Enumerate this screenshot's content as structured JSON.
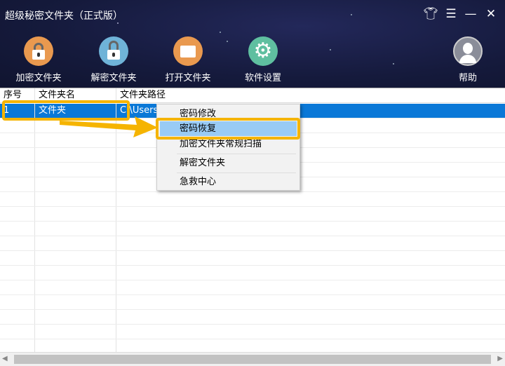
{
  "window": {
    "title": "超级秘密文件夹（正式版）",
    "controls": [
      "skin",
      "menu",
      "minimize",
      "close"
    ]
  },
  "toolbar": [
    {
      "label": "加密文件夹",
      "icon": "lock-icon",
      "color": "#e9994f"
    },
    {
      "label": "解密文件夹",
      "icon": "unlock-icon",
      "color": "#6fb3d8"
    },
    {
      "label": "打开文件夹",
      "icon": "folder-icon",
      "color": "#e9994f"
    },
    {
      "label": "软件设置",
      "icon": "gear-icon",
      "color": "#5fbfa0"
    }
  ],
  "help": {
    "label": "帮助"
  },
  "table": {
    "headers": [
      "序号",
      "文件夹名",
      "文件夹路径"
    ],
    "rows": [
      {
        "index": "1",
        "name": "文件夹",
        "path": "C:\\Users"
      }
    ]
  },
  "context_menu": {
    "items": [
      "密码修改",
      "密码恢复",
      "加密文件夹常规扫描",
      "解密文件夹",
      "急救中心"
    ],
    "highlighted": "密码恢复"
  }
}
